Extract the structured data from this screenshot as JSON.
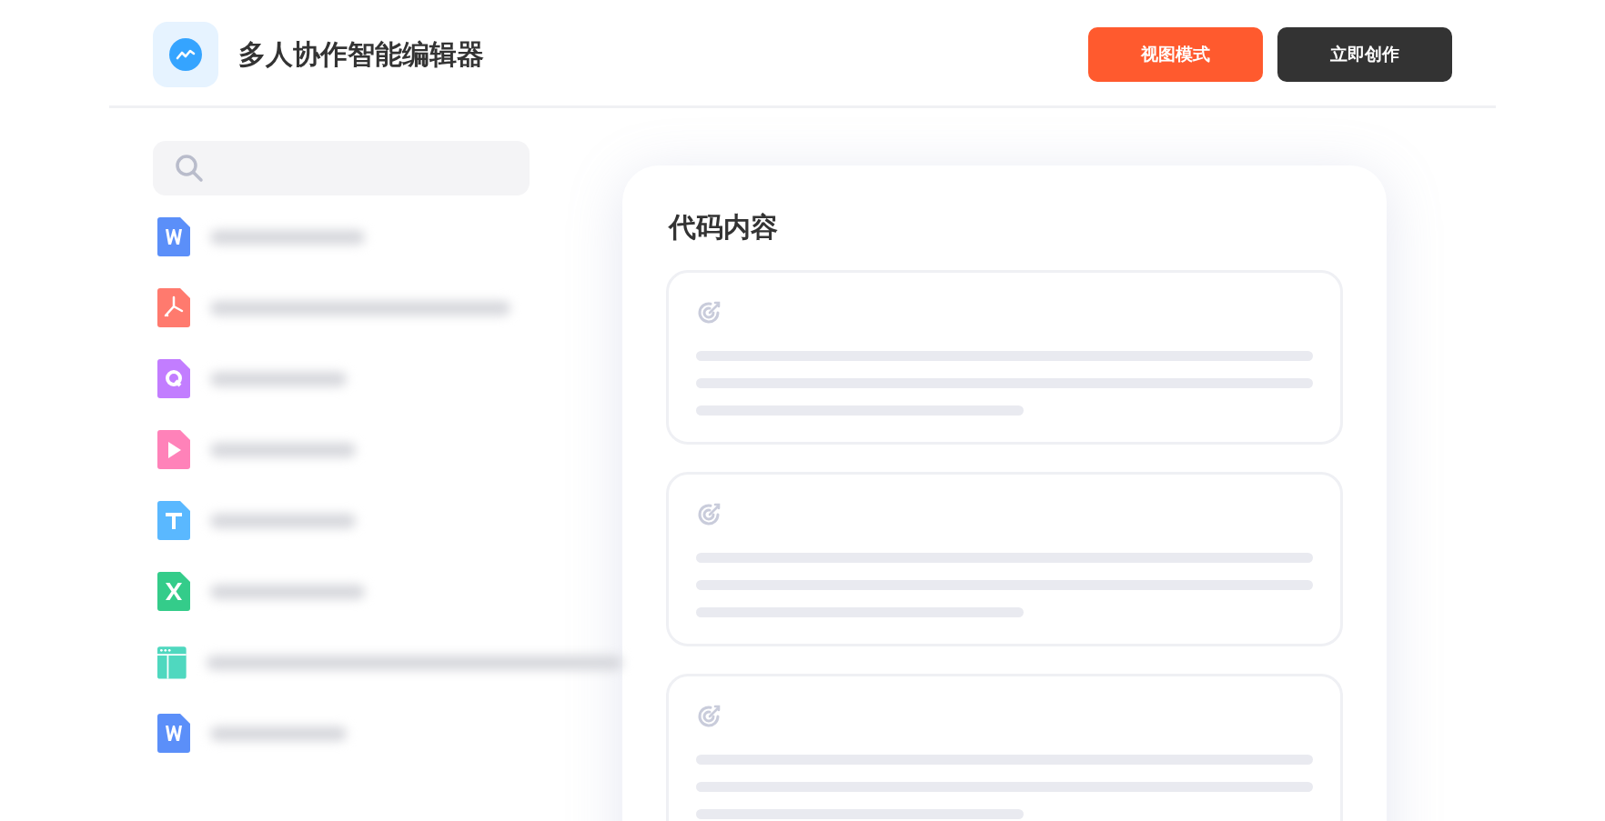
{
  "header": {
    "title": "多人协作智能编辑器",
    "buttons": [
      {
        "label": "视图模式",
        "kind": "primary"
      },
      {
        "label": "立即创作",
        "kind": "dark"
      }
    ]
  },
  "files": [
    {
      "kind": "word"
    },
    {
      "kind": "pdf"
    },
    {
      "kind": "quick"
    },
    {
      "kind": "video"
    },
    {
      "kind": "text"
    },
    {
      "kind": "excel"
    },
    {
      "kind": "web"
    },
    {
      "kind": "word"
    }
  ],
  "panel": {
    "title": "代码内容",
    "cards": [
      {
        "kind": "skeleton"
      },
      {
        "kind": "skeleton"
      },
      {
        "kind": "skeleton"
      }
    ]
  }
}
